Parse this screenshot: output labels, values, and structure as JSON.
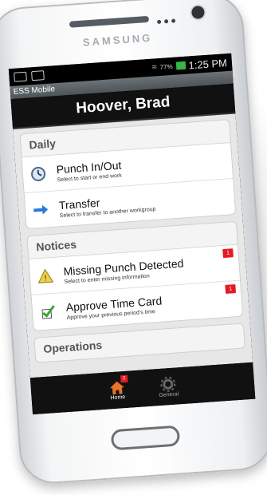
{
  "device": {
    "brand": "SAMSUNG"
  },
  "status_bar": {
    "time": "1:25 PM",
    "battery": "77%"
  },
  "app": {
    "name": "ESS Mobile",
    "user_name": "Hoover, Brad"
  },
  "sections": {
    "daily": {
      "title": "Daily",
      "items": [
        {
          "title": "Punch In/Out",
          "subtitle": "Select to start or end work",
          "icon": "clock-icon"
        },
        {
          "title": "Transfer",
          "subtitle": "Select to transfer to another workgroup",
          "icon": "arrow-right-icon"
        }
      ]
    },
    "notices": {
      "title": "Notices",
      "items": [
        {
          "title": "Missing Punch Detected",
          "subtitle": "Select to enter missing information",
          "badge": "1",
          "icon": "warning-icon"
        },
        {
          "title": "Approve Time Card",
          "subtitle": "Approve your previous period's time",
          "badge": "1",
          "icon": "checkmark-icon"
        }
      ]
    },
    "operations": {
      "title": "Operations"
    }
  },
  "tabs": [
    {
      "label": "Home",
      "badge": "2",
      "icon": "home-icon",
      "active": true
    },
    {
      "label": "General",
      "icon": "gear-icon",
      "active": false
    }
  ],
  "colors": {
    "badge": "#e41b23",
    "accent_blue": "#2a7bd8",
    "check_green": "#3aa636"
  }
}
